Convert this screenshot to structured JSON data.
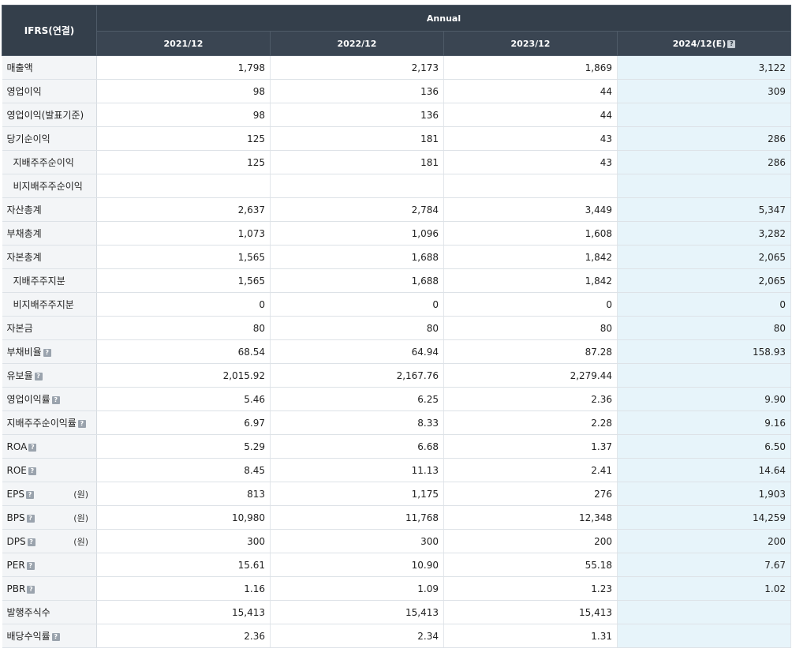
{
  "header": {
    "corner": "IFRS(연결)",
    "group": "Annual",
    "columns": [
      "2021/12",
      "2022/12",
      "2023/12",
      "2024/12(E)"
    ],
    "estimate_help_icon": "help-icon"
  },
  "rows": [
    {
      "label": "매출액",
      "indent": false,
      "help": false,
      "unit": "",
      "values": [
        "1,798",
        "2,173",
        "1,869",
        "3,122"
      ]
    },
    {
      "label": "영업이익",
      "indent": false,
      "help": false,
      "unit": "",
      "values": [
        "98",
        "136",
        "44",
        "309"
      ]
    },
    {
      "label": "영업이익(발표기준)",
      "indent": false,
      "help": false,
      "unit": "",
      "values": [
        "98",
        "136",
        "44",
        ""
      ]
    },
    {
      "label": "당기순이익",
      "indent": false,
      "help": false,
      "unit": "",
      "values": [
        "125",
        "181",
        "43",
        "286"
      ]
    },
    {
      "label": "지배주주순이익",
      "indent": true,
      "help": false,
      "unit": "",
      "values": [
        "125",
        "181",
        "43",
        "286"
      ]
    },
    {
      "label": "비지배주주순이익",
      "indent": true,
      "help": false,
      "unit": "",
      "values": [
        "",
        "",
        "",
        ""
      ]
    },
    {
      "label": "자산총계",
      "indent": false,
      "help": false,
      "unit": "",
      "values": [
        "2,637",
        "2,784",
        "3,449",
        "5,347"
      ]
    },
    {
      "label": "부채총계",
      "indent": false,
      "help": false,
      "unit": "",
      "values": [
        "1,073",
        "1,096",
        "1,608",
        "3,282"
      ]
    },
    {
      "label": "자본총계",
      "indent": false,
      "help": false,
      "unit": "",
      "values": [
        "1,565",
        "1,688",
        "1,842",
        "2,065"
      ]
    },
    {
      "label": "지배주주지분",
      "indent": true,
      "help": false,
      "unit": "",
      "values": [
        "1,565",
        "1,688",
        "1,842",
        "2,065"
      ]
    },
    {
      "label": "비지배주주지분",
      "indent": true,
      "help": false,
      "unit": "",
      "values": [
        "0",
        "0",
        "0",
        "0"
      ]
    },
    {
      "label": "자본금",
      "indent": false,
      "help": false,
      "unit": "",
      "values": [
        "80",
        "80",
        "80",
        "80"
      ]
    },
    {
      "label": "부채비율",
      "indent": false,
      "help": true,
      "unit": "",
      "values": [
        "68.54",
        "64.94",
        "87.28",
        "158.93"
      ]
    },
    {
      "label": "유보율",
      "indent": false,
      "help": true,
      "unit": "",
      "values": [
        "2,015.92",
        "2,167.76",
        "2,279.44",
        ""
      ]
    },
    {
      "label": "영업이익률",
      "indent": false,
      "help": true,
      "unit": "",
      "values": [
        "5.46",
        "6.25",
        "2.36",
        "9.90"
      ]
    },
    {
      "label": "지배주주순이익률",
      "indent": false,
      "help": true,
      "unit": "",
      "values": [
        "6.97",
        "8.33",
        "2.28",
        "9.16"
      ]
    },
    {
      "label": "ROA",
      "indent": false,
      "help": true,
      "unit": "",
      "values": [
        "5.29",
        "6.68",
        "1.37",
        "6.50"
      ]
    },
    {
      "label": "ROE",
      "indent": false,
      "help": true,
      "unit": "",
      "values": [
        "8.45",
        "11.13",
        "2.41",
        "14.64"
      ]
    },
    {
      "label": "EPS",
      "indent": false,
      "help": true,
      "unit": "(원)",
      "values": [
        "813",
        "1,175",
        "276",
        "1,903"
      ]
    },
    {
      "label": "BPS",
      "indent": false,
      "help": true,
      "unit": "(원)",
      "values": [
        "10,980",
        "11,768",
        "12,348",
        "14,259"
      ]
    },
    {
      "label": "DPS",
      "indent": false,
      "help": true,
      "unit": "(원)",
      "values": [
        "300",
        "300",
        "200",
        "200"
      ]
    },
    {
      "label": "PER",
      "indent": false,
      "help": true,
      "unit": "",
      "values": [
        "15.61",
        "10.90",
        "55.18",
        "7.67"
      ]
    },
    {
      "label": "PBR",
      "indent": false,
      "help": true,
      "unit": "",
      "values": [
        "1.16",
        "1.09",
        "1.23",
        "1.02"
      ]
    },
    {
      "label": "발행주식수",
      "indent": false,
      "help": false,
      "unit": "",
      "values": [
        "15,413",
        "15,413",
        "15,413",
        ""
      ]
    },
    {
      "label": "배당수익률",
      "indent": false,
      "help": true,
      "unit": "",
      "values": [
        "2.36",
        "2.34",
        "1.31",
        ""
      ]
    }
  ],
  "colors": {
    "header_bg": "#343f4b",
    "estimate_bg": "#e7f4fa",
    "label_bg": "#f3f5f7"
  }
}
